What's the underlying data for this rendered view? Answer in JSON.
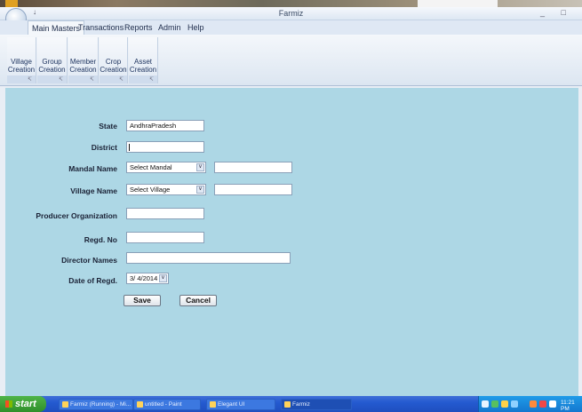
{
  "window": {
    "title": "Farmiz",
    "qat_glyph": "↓",
    "controls": "_ □"
  },
  "menu": [
    {
      "label": "Main Masters",
      "active": true
    },
    {
      "label": "Transactions"
    },
    {
      "label": "Reports"
    },
    {
      "label": "Admin"
    },
    {
      "label": "Help"
    }
  ],
  "ribbon": [
    {
      "line1": "Village",
      "line2": "Creation"
    },
    {
      "line1": "Group",
      "line2": "Creation"
    },
    {
      "line1": "Member",
      "line2": "Creation"
    },
    {
      "line1": "Crop",
      "line2": "Creation"
    },
    {
      "line1": "Asset",
      "line2": "Creation"
    }
  ],
  "ribbon_launcher_glyph": "↸",
  "form": {
    "state": {
      "label": "State",
      "value": "AndhraPradesh"
    },
    "district": {
      "label": "District",
      "value": ""
    },
    "mandal": {
      "label": "Mandal Name",
      "value": "Select Mandal",
      "extra": ""
    },
    "village": {
      "label": "Village Name",
      "value": "Select Village",
      "extra": ""
    },
    "producer": {
      "label": "Producer Organization",
      "value": ""
    },
    "regd_no": {
      "label": "Regd. No",
      "value": ""
    },
    "directors": {
      "label": "Director Names",
      "value": ""
    },
    "date": {
      "label": "Date of Regd.",
      "value": "3/ 4/2014"
    },
    "dropdown_glyph": "∨",
    "save_label": "Save",
    "cancel_label": "Cancel"
  },
  "taskbar": {
    "start_label": "start",
    "tasks": [
      {
        "label": "Farmiz (Running) - Mi..."
      },
      {
        "label": "untitled - Paint"
      },
      {
        "label": "Elegant UI"
      },
      {
        "label": "Farmiz",
        "active": true
      }
    ],
    "clock": "11:21 PM",
    "colors": {
      "taskbar": "#245ad0",
      "start": "#3a9e33",
      "tray": "#1886dc",
      "content_bg": "#add7e5"
    }
  }
}
